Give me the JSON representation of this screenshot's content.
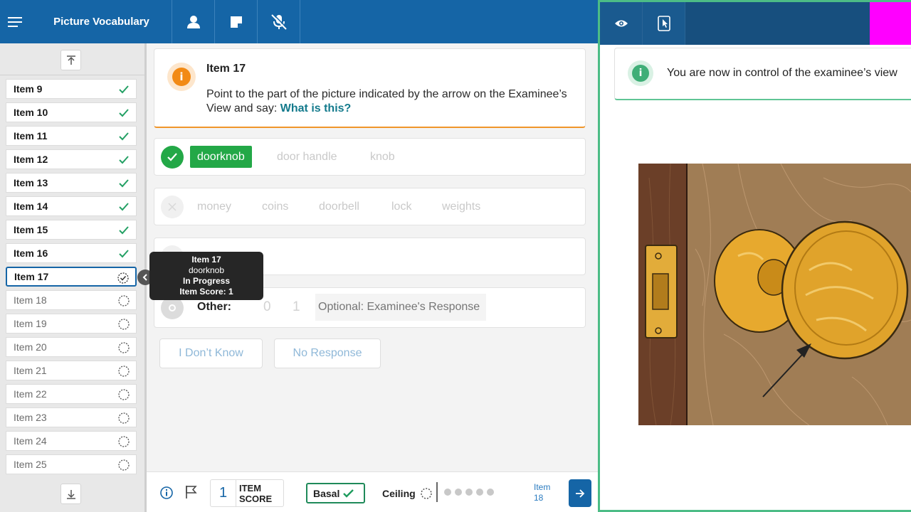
{
  "app": {
    "title": "Picture Vocabulary"
  },
  "sidebar": {
    "items": [
      {
        "label": "Item 9",
        "status": "complete"
      },
      {
        "label": "Item 10",
        "status": "complete"
      },
      {
        "label": "Item 11",
        "status": "complete"
      },
      {
        "label": "Item 12",
        "status": "complete"
      },
      {
        "label": "Item 13",
        "status": "complete"
      },
      {
        "label": "Item 14",
        "status": "complete"
      },
      {
        "label": "Item 15",
        "status": "complete"
      },
      {
        "label": "Item 16",
        "status": "complete"
      },
      {
        "label": "Item 17",
        "status": "in-progress"
      },
      {
        "label": "Item 18",
        "status": "not-started"
      },
      {
        "label": "Item 19",
        "status": "not-started"
      },
      {
        "label": "Item 20",
        "status": "not-started"
      },
      {
        "label": "Item 21",
        "status": "not-started"
      },
      {
        "label": "Item 22",
        "status": "not-started"
      },
      {
        "label": "Item 23",
        "status": "not-started"
      },
      {
        "label": "Item 24",
        "status": "not-started"
      },
      {
        "label": "Item 25",
        "status": "not-started"
      }
    ]
  },
  "prompt": {
    "title": "Item 17",
    "instruction": "Point to the part of the picture indicated by the arrow on the Examinee’s View and say: ",
    "question": "What is this?"
  },
  "responses": {
    "correct": [
      "doorknob",
      "door handle",
      "knob"
    ],
    "incorrect": [
      "money",
      "coins",
      "doorbell",
      "lock",
      "weights"
    ],
    "other_label": "Other:",
    "other_scores": [
      "0",
      "1"
    ],
    "other_placeholder": "Optional: Examinee's Response",
    "dont_know": "I Don’t Know",
    "no_response": "No Response"
  },
  "tooltip": {
    "item": "Item 17",
    "response": "doorknob",
    "status": "In Progress",
    "score": "Item Score: 1"
  },
  "footer": {
    "item_score": "1",
    "item_score_label": "ITEM SCORE",
    "basal": "Basal",
    "ceiling": "Ceiling",
    "next_label_1": "Item",
    "next_label_2": "18"
  },
  "examinee": {
    "notice": "You are now in control of the examinee’s view"
  },
  "colors": {
    "topbar": "#1565a6",
    "correct_green": "#23a847",
    "prompt_accent": "#f0962a",
    "examinee_border": "#4cbc86",
    "magenta": "#ff00ff"
  }
}
